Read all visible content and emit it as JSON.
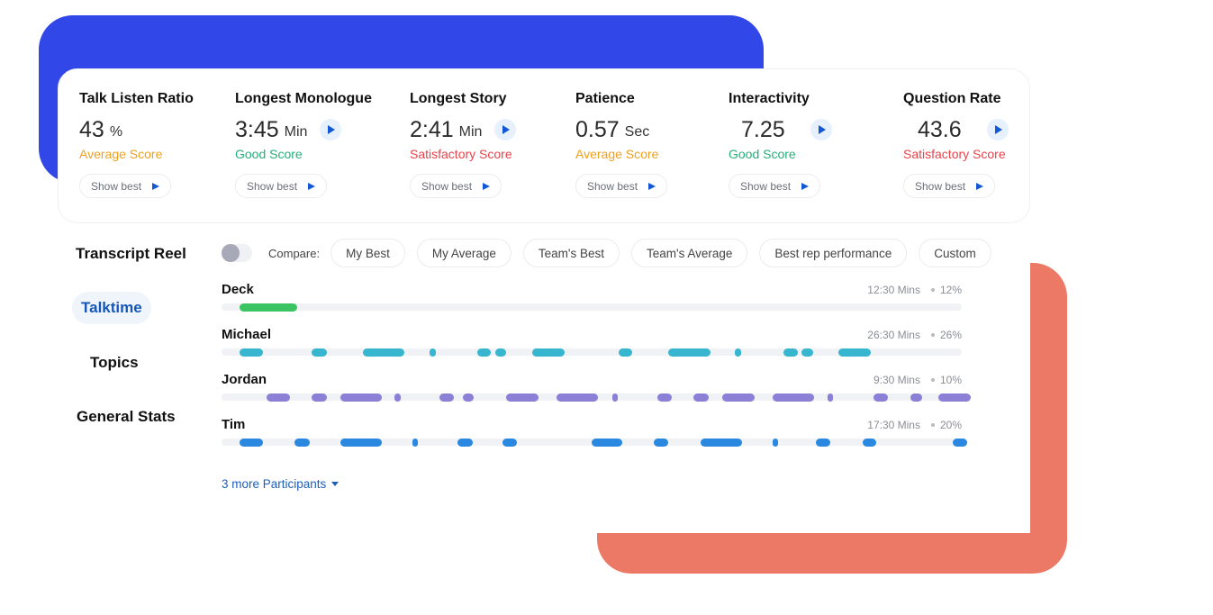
{
  "colors": {
    "blue_decor": "#3147e8",
    "coral_decor": "#ec7966",
    "average": "#f0a020",
    "good": "#25b07a",
    "satisfactory": "#e9434a",
    "play": "#1457d4",
    "deck": "#3cc463",
    "michael": "#38b6d0",
    "jordan": "#8b7fd6",
    "tim": "#2b88e0",
    "active_nav": "#1457b8"
  },
  "metrics": [
    {
      "title": "Talk Listen Ratio",
      "value": "43",
      "unit": "%",
      "score": "Average Score",
      "score_type": "average",
      "has_play": false,
      "show_best": "Show best"
    },
    {
      "title": "Longest Monologue",
      "value": "3:45",
      "unit": "Min",
      "score": "Good Score",
      "score_type": "good",
      "has_play": true,
      "show_best": "Show best"
    },
    {
      "title": "Longest Story",
      "value": "2:41",
      "unit": "Min",
      "score": "Satisfactory Score",
      "score_type": "satisfactory",
      "has_play": true,
      "show_best": "Show best"
    },
    {
      "title": "Patience",
      "value": "0.57",
      "unit": "Sec",
      "score": "Average Score",
      "score_type": "average",
      "has_play": false,
      "show_best": "Show best"
    },
    {
      "title": "Interactivity",
      "value": "7.25",
      "unit": "",
      "score": "Good Score",
      "score_type": "good",
      "has_play": true,
      "show_best": "Show best"
    },
    {
      "title": "Question Rate",
      "value": "43.6",
      "unit": "",
      "score": "Satisfactory Score",
      "score_type": "satisfactory",
      "has_play": true,
      "show_best": "Show best"
    }
  ],
  "sidebar": {
    "title": "Transcript Reel",
    "items": [
      {
        "label": "Talktime",
        "active": true
      },
      {
        "label": "Topics",
        "active": false
      },
      {
        "label": "General Stats",
        "active": false
      }
    ]
  },
  "compare": {
    "toggle_on": false,
    "label": "Compare:",
    "options": [
      "My Best",
      "My Average",
      "Team's Best",
      "Team's Average",
      "Best rep performance",
      "Custom"
    ]
  },
  "participants": [
    {
      "name": "Deck",
      "duration": "12:30 Mins",
      "percent": "12%",
      "color_key": "deck",
      "segments": [
        [
          0.024,
          0.102
        ]
      ]
    },
    {
      "name": "Michael",
      "duration": "26:30 Mins",
      "percent": "26%",
      "color_key": "michael",
      "segments": [
        [
          0.024,
          0.056
        ],
        [
          0.122,
          0.142
        ],
        [
          0.191,
          0.247
        ],
        [
          0.281,
          0.289
        ],
        [
          0.345,
          0.364
        ],
        [
          0.37,
          0.385
        ],
        [
          0.42,
          0.464
        ],
        [
          0.536,
          0.555
        ],
        [
          0.604,
          0.66
        ],
        [
          0.694,
          0.702
        ],
        [
          0.759,
          0.778
        ],
        [
          0.784,
          0.799
        ],
        [
          0.833,
          0.877
        ]
      ]
    },
    {
      "name": "Jordan",
      "duration": "9:30 Mins",
      "percent": "10%",
      "color_key": "jordan",
      "segments": [
        [
          0.061,
          0.092
        ],
        [
          0.122,
          0.142
        ],
        [
          0.16,
          0.216
        ],
        [
          0.234,
          0.242
        ],
        [
          0.294,
          0.314
        ],
        [
          0.326,
          0.341
        ],
        [
          0.384,
          0.428
        ],
        [
          0.452,
          0.508
        ],
        [
          0.528,
          0.535
        ],
        [
          0.589,
          0.608
        ],
        [
          0.638,
          0.658
        ],
        [
          0.676,
          0.72
        ],
        [
          0.744,
          0.8
        ],
        [
          0.819,
          0.826
        ],
        [
          0.881,
          0.9
        ],
        [
          0.931,
          0.946
        ],
        [
          0.968,
          1.012
        ]
      ]
    },
    {
      "name": "Tim",
      "duration": "17:30 Mins",
      "percent": "20%",
      "color_key": "tim",
      "segments": [
        [
          0.024,
          0.056
        ],
        [
          0.099,
          0.119
        ],
        [
          0.16,
          0.216
        ],
        [
          0.258,
          0.265
        ],
        [
          0.319,
          0.339
        ],
        [
          0.38,
          0.399
        ],
        [
          0.5,
          0.541
        ],
        [
          0.584,
          0.603
        ],
        [
          0.647,
          0.703
        ],
        [
          0.745,
          0.752
        ],
        [
          0.803,
          0.822
        ],
        [
          0.866,
          0.885
        ],
        [
          0.988,
          1.007
        ]
      ]
    }
  ],
  "more_participants": "3 more Participants"
}
